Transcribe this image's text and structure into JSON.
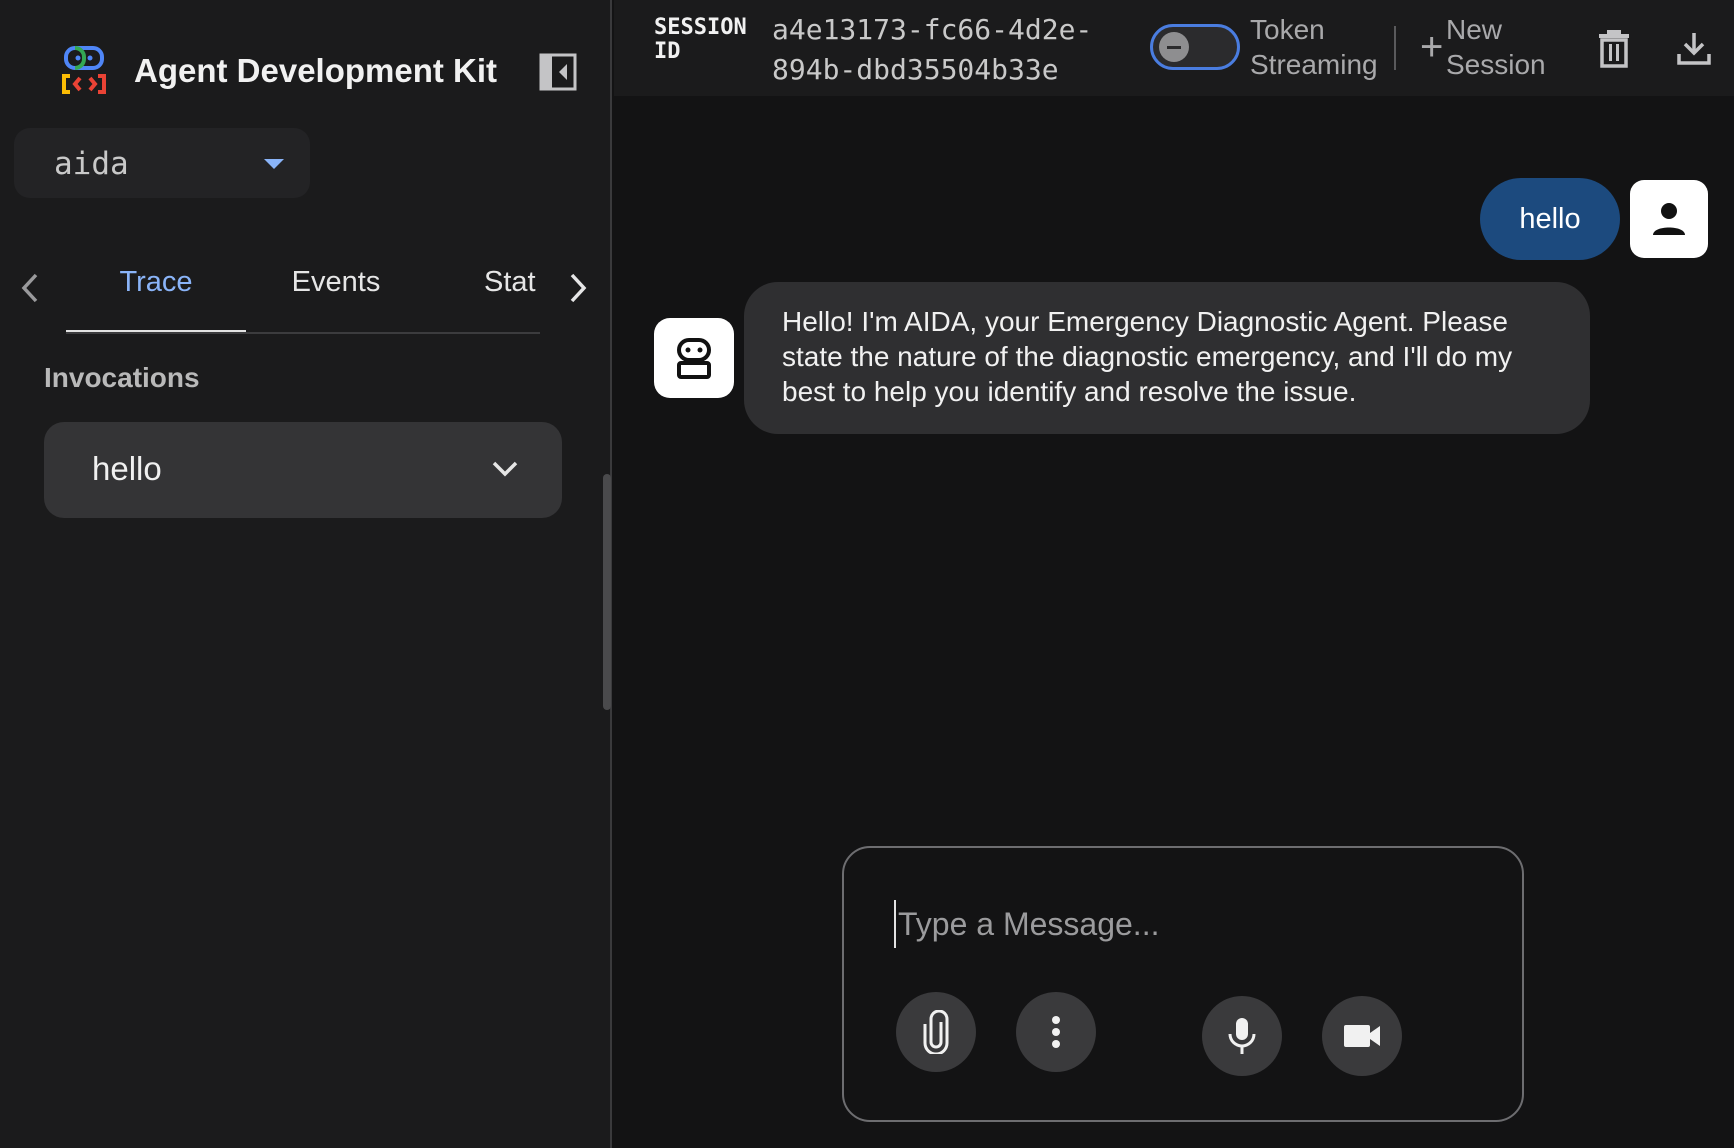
{
  "sidebar": {
    "brand_title": "Agent Development Kit",
    "app_selector": {
      "value": "aida"
    },
    "tabs": [
      {
        "label": "Trace",
        "active": true
      },
      {
        "label": "Events",
        "active": false
      },
      {
        "label": "Stat",
        "active": false
      }
    ],
    "invocations_title": "Invocations",
    "invocations": [
      {
        "label": "hello"
      }
    ]
  },
  "header": {
    "session_label": "SESSION ID",
    "session_id": "a4e13173-fc66-4d2e-894b-dbd35504b33e",
    "token_streaming_label": "Token Streaming",
    "token_streaming_on": false,
    "new_session_label": "New Session"
  },
  "chat": {
    "messages": [
      {
        "role": "user",
        "text": "hello"
      },
      {
        "role": "agent",
        "text": "Hello! I'm AIDA, your Emergency Diagnostic Agent. Please state the nature of the diagnostic emergency, and I'll do my best to help you identify and resolve the issue."
      }
    ],
    "composer_placeholder": "Type a Message..."
  },
  "colors": {
    "accent": "#8ab4f8",
    "user_bubble": "#1c4a7e",
    "toggle_border": "#4a7de0"
  },
  "icons": [
    "adk-logo-icon",
    "collapse-panel-icon",
    "caret-down-icon",
    "chevron-left-icon",
    "chevron-right-icon",
    "chevron-down-icon",
    "plus-icon",
    "delete-icon",
    "download-icon",
    "person-icon",
    "robot-icon",
    "attach-icon",
    "more-vert-icon",
    "mic-icon",
    "videocam-icon"
  ]
}
